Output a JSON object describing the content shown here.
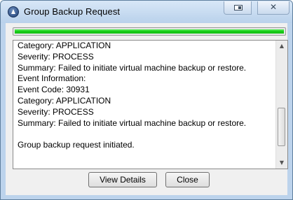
{
  "window": {
    "title": "Group Backup Request",
    "controls": {
      "restore_icon": "restore-icon",
      "close_glyph": "✕"
    }
  },
  "progress": {
    "fraction": 1.0,
    "color": "#1ec41e"
  },
  "log": {
    "lines": [
      "Category: APPLICATION",
      "Severity: PROCESS",
      "Summary: Failed to initiate virtual machine backup or restore.",
      "Event Information:",
      "Event Code: 30931",
      "Category: APPLICATION",
      "Severity: PROCESS",
      "Summary: Failed to initiate virtual machine backup or restore.",
      "",
      "Group backup request initiated."
    ]
  },
  "buttons": {
    "view_details": "View Details",
    "close": "Close"
  }
}
